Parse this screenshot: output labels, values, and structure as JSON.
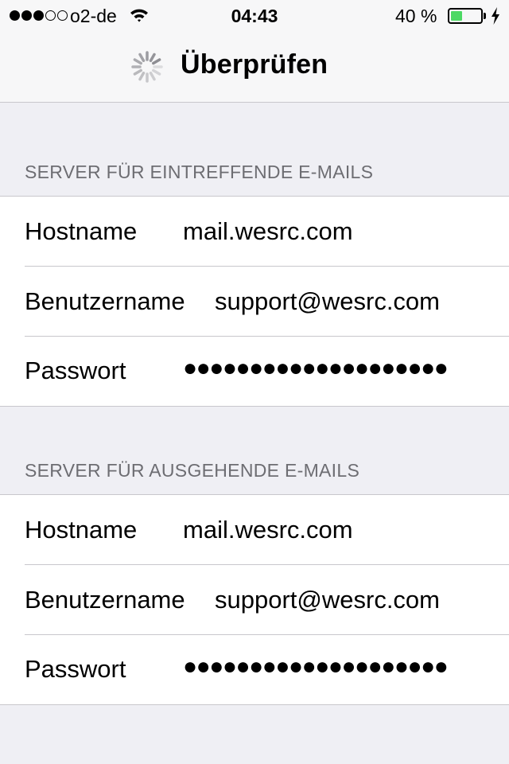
{
  "status_bar": {
    "signal_dots": [
      true,
      true,
      true,
      false,
      false
    ],
    "carrier": "o2-de",
    "wifi_icon": "wifi-icon",
    "time": "04:43",
    "battery_percent": "40 %",
    "battery_level": 0.4,
    "battery_color": "#4cd964",
    "charging_icon": "bolt-icon"
  },
  "nav": {
    "spinner_icon": "activity-spinner-icon",
    "title": "Überprüfen"
  },
  "incoming": {
    "header": "SERVER FÜR EINTREFFENDE E-MAILS",
    "hostname_label": "Hostname",
    "hostname_value": "mail.wesrc.com",
    "username_label": "Benutzername",
    "username_value": "support@wesrc.com",
    "password_label": "Passwort",
    "password_value": "●●●●●●●●●●●●●●●●●●●●"
  },
  "outgoing": {
    "header": "SERVER FÜR AUSGEHENDE E-MAILS",
    "hostname_label": "Hostname",
    "hostname_value": "mail.wesrc.com",
    "username_label": "Benutzername",
    "username_value": "support@wesrc.com",
    "password_label": "Passwort",
    "password_value": "●●●●●●●●●●●●●●●●●●●●"
  }
}
